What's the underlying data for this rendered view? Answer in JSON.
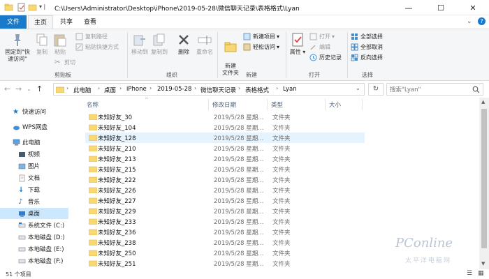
{
  "window": {
    "title": "C:\\Users\\Administrator\\Desktop\\iPhone\\2019-05-28\\微信聊天记录\\表格格式\\Lyan"
  },
  "ribbon_tabs": [
    "文件",
    "主页",
    "共享",
    "查看"
  ],
  "ribbon": {
    "clipboard": {
      "pin": "固定到\"快速访问\"",
      "copy": "复制",
      "paste": "粘贴",
      "copy_path": "复制路径",
      "paste_shortcut": "粘贴快捷方式",
      "cut": "剪切",
      "label": "剪贴板"
    },
    "organize": {
      "move_to": "移动到",
      "copy_to": "复制到",
      "delete": "删除",
      "rename": "重命名",
      "label": "组织"
    },
    "new": {
      "new_folder": "新建\n文件夹",
      "new_item": "新建项目",
      "easy_access": "轻松访问",
      "label": "新建"
    },
    "open": {
      "properties": "属性",
      "open": "打开",
      "edit": "编辑",
      "history": "历史记录",
      "label": "打开"
    },
    "select": {
      "select_all": "全部选择",
      "select_none": "全部取消",
      "invert": "反向选择",
      "label": "选择"
    }
  },
  "address": {
    "crumbs": [
      "此电脑",
      "桌面",
      "iPhone",
      "2019-05-28",
      "微信聊天记录",
      "表格格式",
      "Lyan"
    ],
    "search_placeholder": "搜索\"Lyan\""
  },
  "nav": [
    {
      "label": "快速访问",
      "icon": "star-icon"
    },
    {
      "label": "WPS网盘",
      "icon": "cloud-icon"
    },
    {
      "label": "此电脑",
      "icon": "computer-icon"
    },
    {
      "label": "视频",
      "icon": "video-icon"
    },
    {
      "label": "图片",
      "icon": "picture-icon"
    },
    {
      "label": "文档",
      "icon": "document-icon"
    },
    {
      "label": "下载",
      "icon": "download-icon"
    },
    {
      "label": "音乐",
      "icon": "music-icon"
    },
    {
      "label": "桌面",
      "icon": "desktop-icon"
    },
    {
      "label": "系统文件 (C:)",
      "icon": "drive-icon"
    },
    {
      "label": "本地磁盘 (D:)",
      "icon": "drive-icon"
    },
    {
      "label": "本地磁盘 (E:)",
      "icon": "drive-icon"
    },
    {
      "label": "本地磁盘 (F:)",
      "icon": "drive-icon"
    }
  ],
  "columns": [
    "名称",
    "修改日期",
    "类型",
    "大小"
  ],
  "files": [
    {
      "name": "未知好友_30",
      "date": "2019/5/28 星期...",
      "type": "文件夹"
    },
    {
      "name": "未知好友_104",
      "date": "2019/5/28 星期...",
      "type": "文件夹"
    },
    {
      "name": "未知好友_128",
      "date": "2019/5/28 星期...",
      "type": "文件夹"
    },
    {
      "name": "未知好友_210",
      "date": "2019/5/28 星期...",
      "type": "文件夹"
    },
    {
      "name": "未知好友_213",
      "date": "2019/5/28 星期...",
      "type": "文件夹"
    },
    {
      "name": "未知好友_215",
      "date": "2019/5/28 星期...",
      "type": "文件夹"
    },
    {
      "name": "未知好友_222",
      "date": "2019/5/28 星期...",
      "type": "文件夹"
    },
    {
      "name": "未知好友_226",
      "date": "2019/5/28 星期...",
      "type": "文件夹"
    },
    {
      "name": "未知好友_227",
      "date": "2019/5/28 星期...",
      "type": "文件夹"
    },
    {
      "name": "未知好友_229",
      "date": "2019/5/28 星期...",
      "type": "文件夹"
    },
    {
      "name": "未知好友_233",
      "date": "2019/5/28 星期...",
      "type": "文件夹"
    },
    {
      "name": "未知好友_236",
      "date": "2019/5/28 星期...",
      "type": "文件夹"
    },
    {
      "name": "未知好友_238",
      "date": "2019/5/28 星期...",
      "type": "文件夹"
    },
    {
      "name": "未知好友_250",
      "date": "2019/5/28 星期...",
      "type": "文件夹"
    },
    {
      "name": "未知好友_251",
      "date": "2019/5/28 星期...",
      "type": "文件夹"
    }
  ],
  "status": {
    "count": "51 个项目"
  },
  "watermark": {
    "brand": "PConline",
    "sub": "太平洋电脑网"
  },
  "colors": {
    "accent": "#1979ca",
    "selection": "#cce8ff",
    "folder": "#f8d775"
  }
}
